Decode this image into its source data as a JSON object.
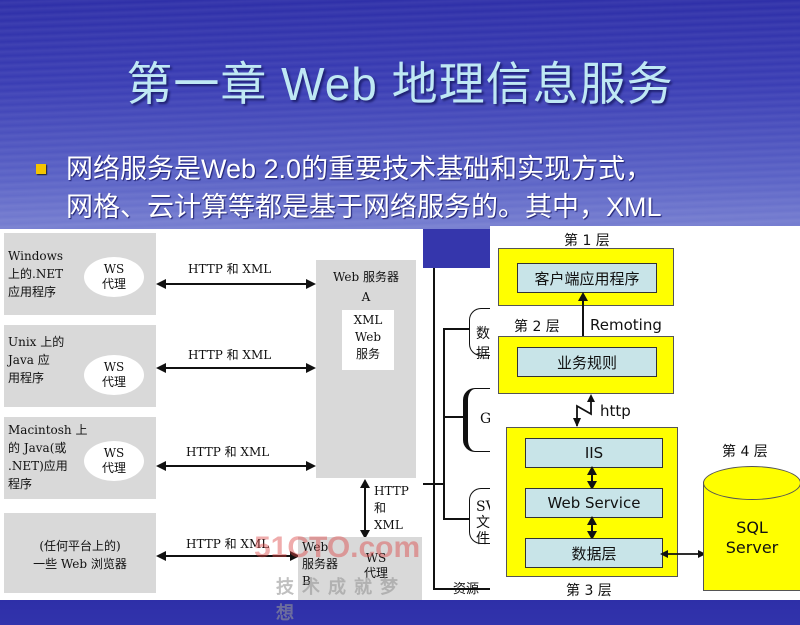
{
  "slide": {
    "title": "第一章 Web 地理信息服务",
    "bullet_lines": [
      "网络服务是Web 2.0的重要技术基础和实现方式，",
      "网格、云计算等都是基于网络服务的。其中，XML"
    ],
    "colors": {
      "title": "#bfe8f4",
      "bullet": "#f4c400",
      "layer_fill": "#ffff00",
      "component_fill": "#c8e4e8"
    }
  },
  "left_diagram": {
    "clients": [
      {
        "lines": [
          "Windows",
          "上的.NET",
          "应用程序"
        ],
        "proxy": [
          "WS",
          "代理"
        ]
      },
      {
        "lines": [
          "Unix 上的",
          "Java 应",
          "用程序"
        ],
        "proxy": [
          "WS",
          "代理"
        ]
      },
      {
        "lines": [
          "Macintosh 上",
          "的 Java(或",
          ".NET)应用",
          "程序"
        ],
        "proxy": [
          "WS",
          "代理"
        ]
      },
      {
        "lines": [
          "(任何平台上的)",
          "一些 Web 浏览器"
        ],
        "proxy": null
      }
    ],
    "connection_label": "HTTP 和 XML",
    "server_a": {
      "title": "Web 服务器",
      "sub": "A",
      "service": [
        "XML",
        "Web",
        "服务"
      ]
    },
    "vertical_link": [
      "HTTP",
      "和",
      "XML"
    ],
    "server_b": {
      "lines": [
        "Web",
        "服务器",
        "B"
      ],
      "proxy": [
        "WS",
        "代理"
      ]
    },
    "watermark": {
      "brand": "51CTO.com",
      "slogan": "技术成就梦想"
    }
  },
  "resource_tree": {
    "items": [
      "数据",
      "G",
      "SVG 文件"
    ],
    "footer": "资源"
  },
  "right_diagram": {
    "layers": [
      {
        "label": "第 1 层",
        "components": [
          "客户端应用程序"
        ]
      },
      {
        "label": "第 2 层",
        "components": [
          "业务规则"
        ]
      },
      {
        "label": "第 3 层",
        "components": [
          "IIS",
          "Web Service",
          "数据层"
        ]
      },
      {
        "label": "第 4 层",
        "components": [
          "SQL",
          "Server"
        ]
      }
    ],
    "link_1_2": "Remoting",
    "link_2_3": "http"
  }
}
